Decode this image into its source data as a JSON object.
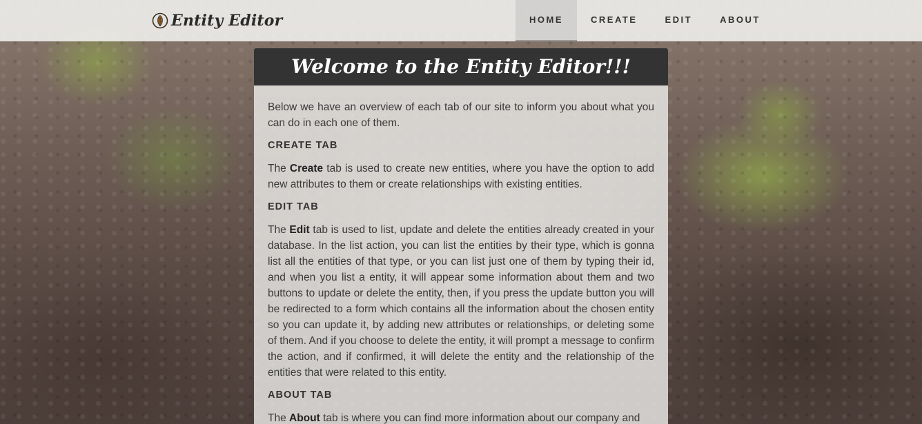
{
  "brand": {
    "name": "Entity Editor",
    "icon": "leaf-icon"
  },
  "nav": {
    "items": [
      {
        "label": "HOME",
        "active": true
      },
      {
        "label": "CREATE",
        "active": false
      },
      {
        "label": "EDIT",
        "active": false
      },
      {
        "label": "ABOUT",
        "active": false
      }
    ]
  },
  "card": {
    "title": "Welcome to the Entity Editor!!!",
    "intro": "Below we have an overview of each tab of our site to inform you about what you can do in each one of them.",
    "sections": [
      {
        "heading": "CREATE TAB",
        "lead": "The ",
        "keyword": "Create",
        "text": " tab is used to create new entities, where you have the option to add new attributes to them or create relationships with existing entities."
      },
      {
        "heading": "EDIT TAB",
        "lead": "The ",
        "keyword": "Edit",
        "text": " tab is used to list, update and delete the entities already created in your database. In the list action, you can list the entities by their type, which is gonna list all the entities of that type, or you can list just one of them by typing their id, and when you list a entity, it will appear some information about them and two buttons to update or delete the entity, then, if you press the update button you will be redirected to a form which contains all the information about the chosen entity so you can update it, by adding new attributes or relationships, or deleting some of them. And if you choose to delete the entity, it will prompt a message to confirm the action, and if confirmed, it will delete the entity and the relationship of the entities that were related to this entity."
      },
      {
        "heading": "ABOUT TAB",
        "lead": "The ",
        "keyword": "About",
        "text": " tab is where you can find more information about our company and"
      }
    ]
  },
  "colors": {
    "header_bg": "#333333",
    "navbar_bg": "#f4f4f2",
    "text": "#3a3a3a"
  }
}
